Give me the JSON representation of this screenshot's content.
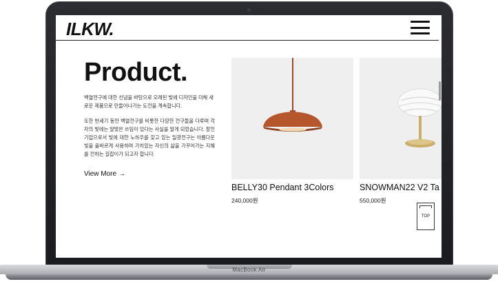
{
  "site": {
    "logo": "ILKW.",
    "menu_icon": "hamburger-menu-icon"
  },
  "hero": {
    "title": "Product.",
    "intro": "백열전구에 대한 신념을 바탕으로 오래된 빛에 디자인을 더해 새로운 제품으로 만들어나가는 도전을 계속합니다.",
    "description": "또한 반세기 동안 백열전구를 비롯한 다양한 전구들을 다루며 각자의 빛에는 알맞은 쓰임이 있다는 사실을 알게 되었습니다. 장인기업으로서 빛에 대한 노하우를 갖고 있는 일광전구는 아름다운 빛을 올바르게 사용하며 가치있는 자신의 삶을 가꾸어가는 지혜를 전하는 길잡이가 되고자 합니다.",
    "view_more": "View More",
    "arrow": "→"
  },
  "products": [
    {
      "name": "BELLY30 Pendant 3Colors",
      "price": "240,000원",
      "image": "pendant-lamp-image"
    },
    {
      "name": "SNOWMAN22 V2 Ta",
      "price": "550,000원",
      "image": "table-lamp-image"
    }
  ],
  "top_button": "TOP",
  "laptop": {
    "label": "MacBook Air"
  },
  "colors": {
    "pendant_shade": "#b5562d",
    "brass": "#c9ad6a",
    "card_bg": "#efefef"
  }
}
